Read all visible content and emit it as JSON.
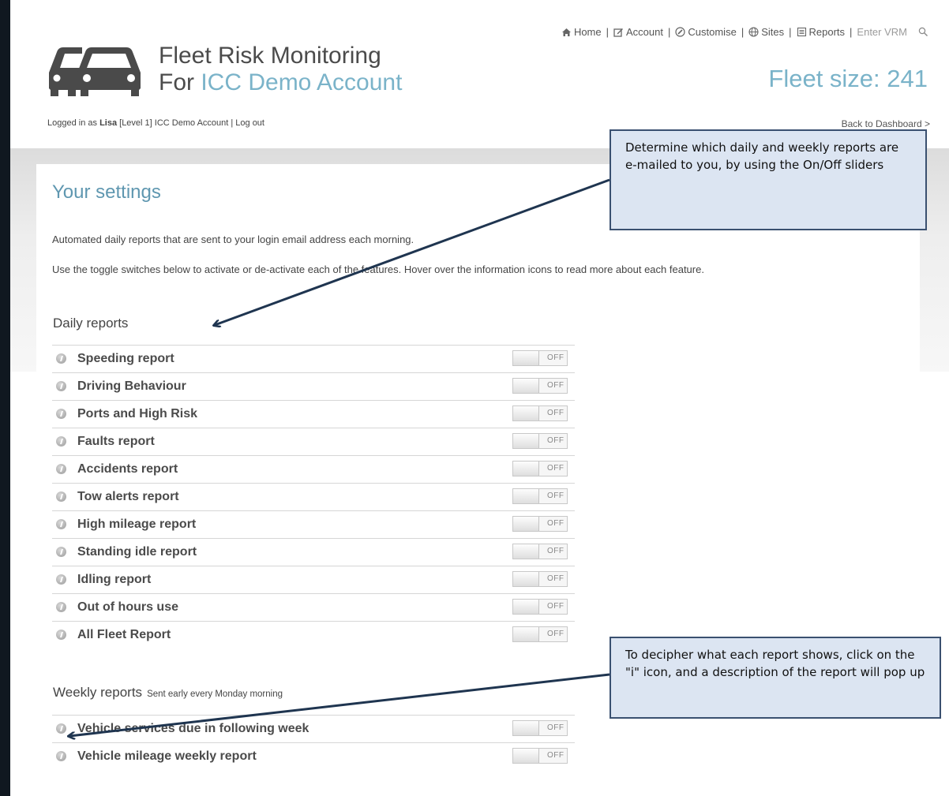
{
  "header": {
    "title_line1": "Fleet Risk Monitoring",
    "title_line2_prefix": "For ",
    "title_line2_account": "ICC Demo Account",
    "fleet_size": "Fleet size: 241"
  },
  "nav": {
    "home": "Home",
    "account": "Account",
    "customise": "Customise",
    "sites": "Sites",
    "reports": "Reports",
    "vrm_placeholder": "Enter VRM",
    "icons": [
      "home-icon",
      "edit-icon",
      "customise-icon",
      "globe-icon",
      "reports-icon",
      "search-icon"
    ]
  },
  "login": {
    "prefix": "Logged in as ",
    "user": "Lisa",
    "level": " [Level 1]  ICC Demo Account  | ",
    "logout": "Log out"
  },
  "back_link": "Back to Dashboard >",
  "main": {
    "title": "Your settings",
    "para1": "Automated daily reports that are sent to your login email address each morning.",
    "para2": "Use the toggle switches below to activate or de-activate each of the features. Hover over the information icons to read more about each feature."
  },
  "daily": {
    "heading": "Daily reports",
    "items": [
      {
        "label": "Speeding report",
        "state": "OFF"
      },
      {
        "label": "Driving Behaviour",
        "state": "OFF"
      },
      {
        "label": "Ports and High Risk",
        "state": "OFF"
      },
      {
        "label": "Faults report",
        "state": "OFF"
      },
      {
        "label": "Accidents report",
        "state": "OFF"
      },
      {
        "label": "Tow alerts report",
        "state": "OFF"
      },
      {
        "label": "High mileage report",
        "state": "OFF"
      },
      {
        "label": "Standing idle report",
        "state": "OFF"
      },
      {
        "label": "Idling report",
        "state": "OFF"
      },
      {
        "label": "Out of hours use",
        "state": "OFF"
      },
      {
        "label": "All Fleet Report",
        "state": "OFF"
      }
    ]
  },
  "weekly": {
    "heading": "Weekly reports",
    "subheading": "Sent early every Monday morning",
    "items": [
      {
        "label": "Vehicle services due in following week",
        "state": "OFF"
      },
      {
        "label": "Vehicle mileage weekly report",
        "state": "OFF"
      }
    ]
  },
  "callouts": {
    "top": "Determine which daily and weekly reports are e-mailed to you, by using the On/Off sliders",
    "bottom": "To decipher what each report shows, click on the \"i\" icon, and a description of the report will pop up"
  },
  "colors": {
    "accent": "#7ab3c9",
    "title_blue": "#5f97b0",
    "callout_bg": "#dce5f2",
    "callout_border": "#3a5070",
    "arrow": "#1f3550"
  }
}
